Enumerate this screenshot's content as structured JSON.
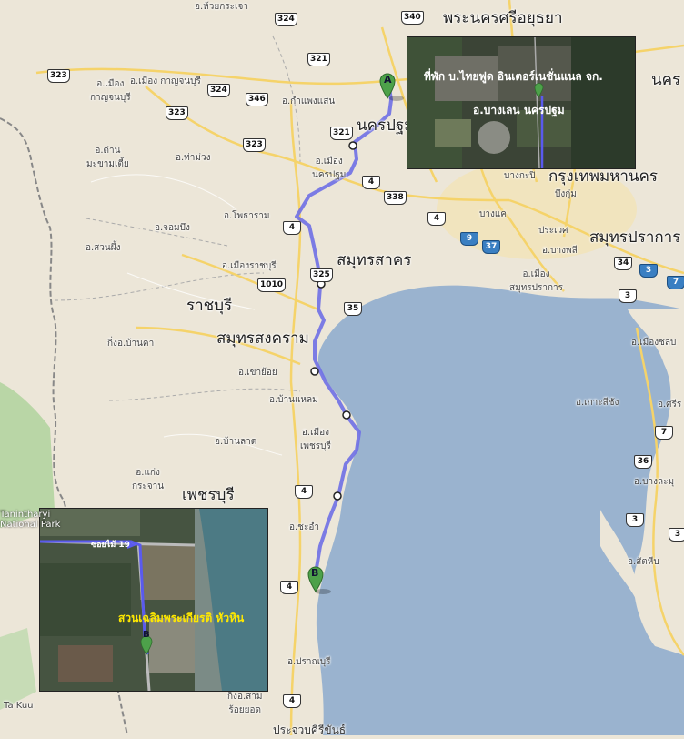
{
  "map": {
    "provinces": {
      "nakhon_pathom": "นครปฐม",
      "ayutthaya": "พระนครศรีอยุธยา",
      "bangkok": "กรุงเทพมหานคร",
      "samut_prakan": "สมุทรปราการ",
      "samut_sakhon": "สมุทรสาคร",
      "ratchaburi": "ราชบุรี",
      "samut_songkhram": "สมุทรสงคราม",
      "phetchaburi": "เพชรบุรี"
    },
    "districts": {
      "huai_krachao": "อ.ห้วยกระเจา",
      "mueang_kanchanaburi": "อ.เมือง\nกาญจนบุรี",
      "kamphaeng_saen": "อ.กำแพงแสน",
      "dan_makham_tia": "อ.ด่าน\nมะขามเตี้ย",
      "tha_muang": "อ.ท่าม่วง",
      "mueang_nakhon_pathom": "อ.เมือง\nนครปฐม",
      "chom_bueng": "อ.จอมบึง",
      "photharam": "อ.โพธาราม",
      "suan_phueng": "อ.สวนผึ้ง",
      "mueang_ratchaburi": "อ.เมืองราชบุรี",
      "king_ban_kha": "กิ่งอ.บ้านคา",
      "khao_yoi": "อ.เขาย้อย",
      "ban_laem": "อ.บ้านแหลม",
      "mueang_phetchaburi": "อ.เมือง\nเพชรบุรี",
      "ban_lat": "อ.บ้านลาด",
      "kaeng_krachan": "อ.แก่ง\nกระจาน",
      "cha_am": "อ.ชะอำ",
      "pran_buri": "อ.ปราณบุรี",
      "king_sam_roi_yot": "กิ่งอ.สาม\nร้อยยอด",
      "bang_kae": "บางแค",
      "bang_kapi": "บางกะปิ",
      "bueng_kum": "บึงกุ่ม",
      "prawet": "ประเวศ",
      "bang_phli": "อ.บางพลี",
      "mueang_samut_prakan": "อ.เมือง\nสมุทรปราการ",
      "mueang_chonburi": "อ.เมืองชลบ",
      "ko_si_chang": "อ.เกาะสีชัง",
      "si_racha": "อ.ศรีร",
      "bang_lamung": "อ.บางละมุ",
      "sattahip": "อ.สัตหีบ",
      "nakhon_short": "นคร",
      "tanintharyi": "Tanintharyi\nNational Park",
      "ta_kuu": "Ta Kuu",
      "bottom_cut": "ประจวบคีรีขันธ์"
    },
    "highways": {
      "h324a": "324",
      "h340": "340",
      "h323a": "323",
      "h321": "321",
      "h324b": "324",
      "h346a": "346",
      "h323b": "323",
      "h323c": "323",
      "h4a": "4",
      "h338": "338",
      "h4b": "4",
      "h4c": "4",
      "h9": "9",
      "h37": "37",
      "h34": "34",
      "h3a": "3",
      "h7": "7",
      "h1010": "1010",
      "h325": "325",
      "h35": "35",
      "h3b": "3",
      "h36": "36",
      "h3c": "3",
      "h4d": "4",
      "h4e": "4",
      "h4f": "4",
      "h7b": "7",
      "h3d": "3"
    },
    "markers": {
      "start": "A",
      "end": "B"
    }
  },
  "inset_top": {
    "caption": "ที่พัก บ.ไทยฟูด อินเตอร์เนชั่นแนล จก.",
    "sub": "อ.บางเลน นครปฐม",
    "marker": "A"
  },
  "inset_bottom": {
    "road_label": "ซอยไม้ 19",
    "caption": "สวนเฉลิมพระเกียรติ หัวหิน",
    "marker": "B"
  },
  "colors": {
    "land": "#ece6d8",
    "sea": "#9ab3cf",
    "route": "#6f6fe6",
    "marker_green": "#4da14a",
    "forest": "#b9d6a6",
    "caption_yellow": "#ffe800"
  }
}
